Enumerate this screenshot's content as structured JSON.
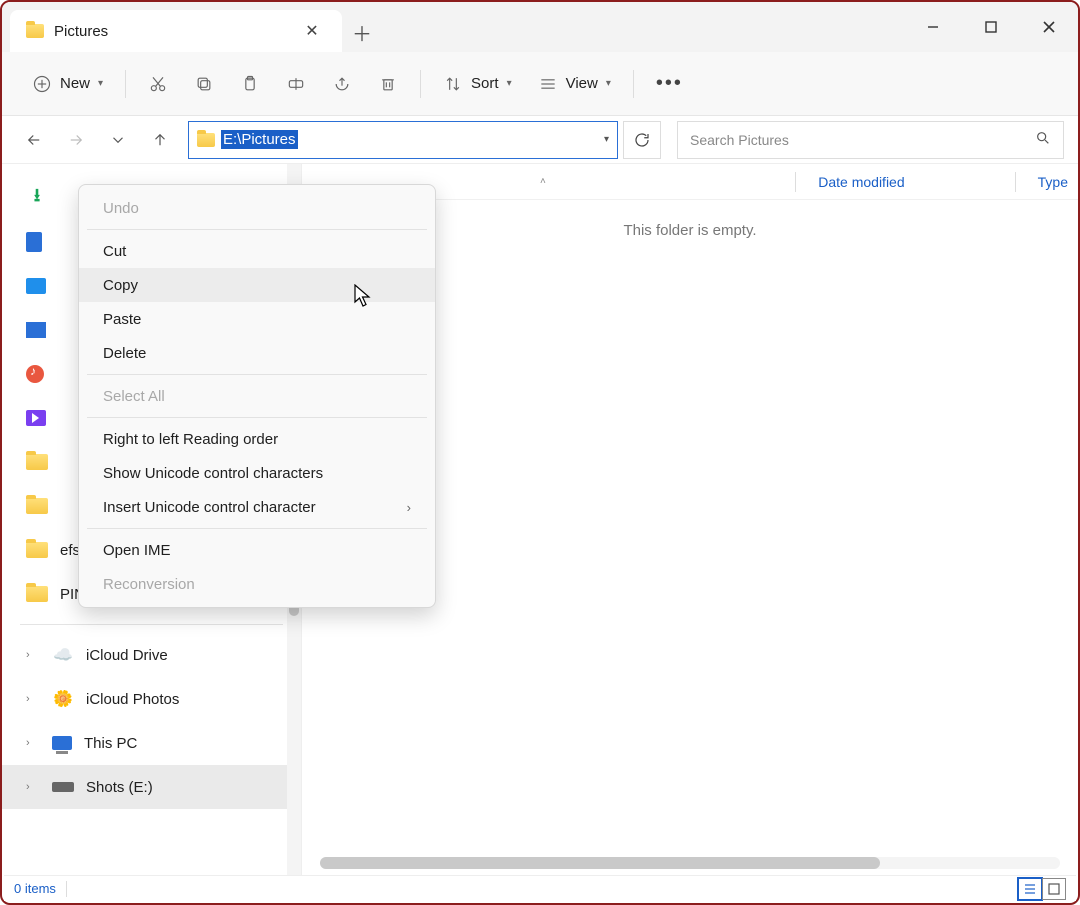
{
  "tab": {
    "title": "Pictures"
  },
  "toolbar": {
    "new_label": "New",
    "sort_label": "Sort",
    "view_label": "View"
  },
  "address": {
    "path": "E:\\Pictures",
    "search_placeholder": "Search Pictures"
  },
  "columns": {
    "date_modified": "Date modified",
    "type": "Type"
  },
  "content": {
    "empty_message": "This folder is empty."
  },
  "sidebar": {
    "items": [
      {
        "label": ""
      },
      {
        "label": ""
      },
      {
        "label": ""
      },
      {
        "label": ""
      },
      {
        "label": ""
      },
      {
        "label": ""
      },
      {
        "label": ""
      },
      {
        "label": ""
      },
      {
        "label": "efs"
      },
      {
        "label": "PING"
      }
    ],
    "nav": [
      {
        "label": "iCloud Drive"
      },
      {
        "label": "iCloud Photos"
      },
      {
        "label": "This PC"
      },
      {
        "label": "Shots (E:)"
      }
    ]
  },
  "context_menu": {
    "undo": "Undo",
    "cut": "Cut",
    "copy": "Copy",
    "paste": "Paste",
    "delete": "Delete",
    "select_all": "Select All",
    "rtl": "Right to left Reading order",
    "show_unicode": "Show Unicode control characters",
    "insert_unicode": "Insert Unicode control character",
    "open_ime": "Open IME",
    "reconversion": "Reconversion"
  },
  "status": {
    "items": "0 items"
  }
}
